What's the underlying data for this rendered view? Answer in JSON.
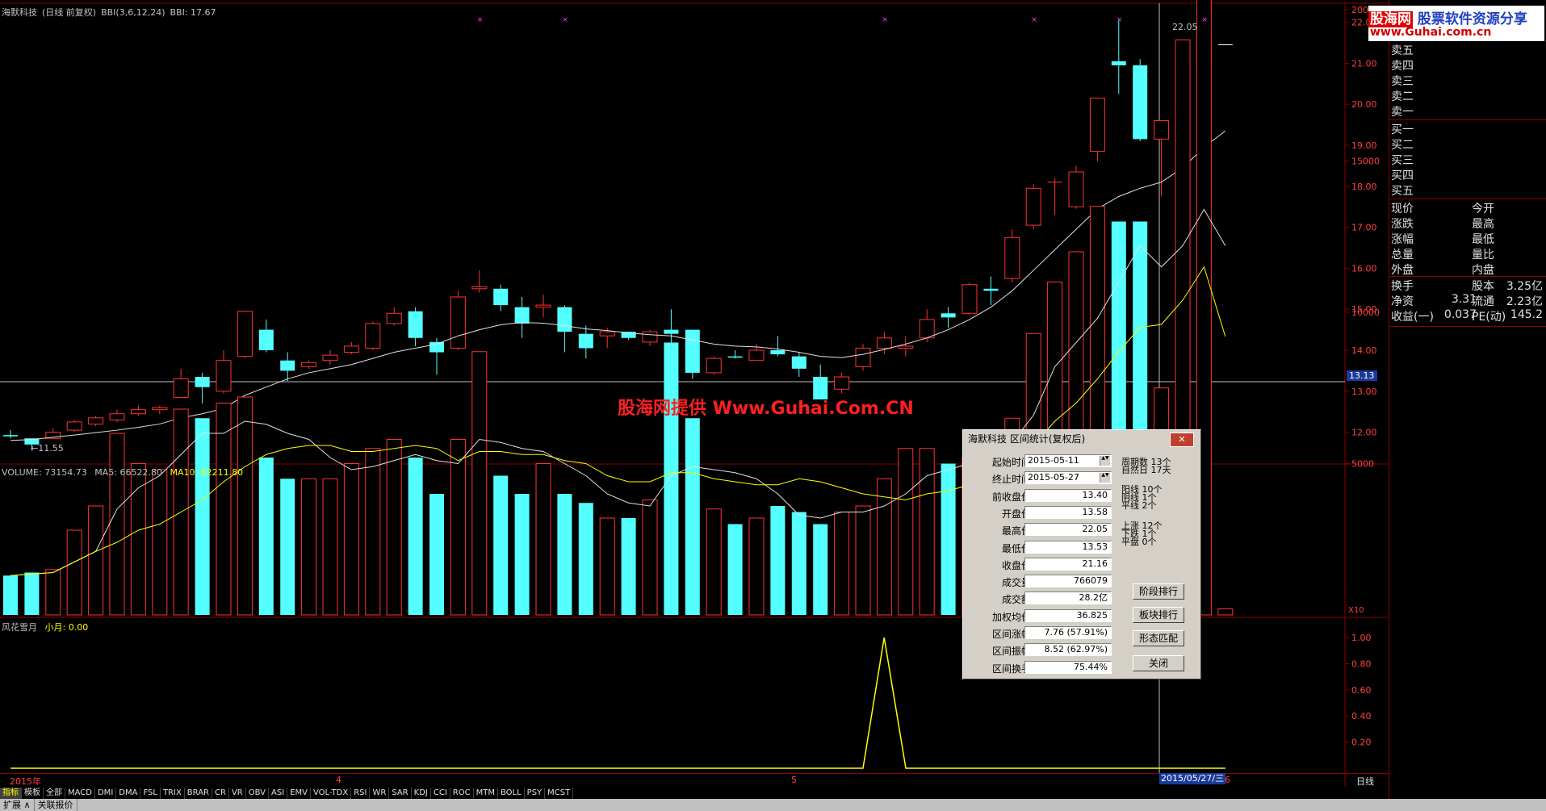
{
  "chart_header": {
    "stock_name": "海默科技",
    "mode": "(日线 前复权)",
    "bbi_params": "BBI(3,6,12,24)",
    "bbi_value": "BBI: 17.67"
  },
  "volume_header": {
    "volume": "VOLUME: 73154.73",
    "ma5": "MA5: 66522.80",
    "ma10": "MA10: 62211.80"
  },
  "indicator_header": {
    "name": "风花雪月",
    "line_label": "小月: 0.00"
  },
  "price_annotations": {
    "high": "22.05",
    "low": "←11.55",
    "crosshair_price": "13.13"
  },
  "watermark": "股海网提供 Www.Guhai.Com.CN",
  "logo": {
    "line1_a": "股海网",
    "line1_b": "股票软件资源分享",
    "line2": "www.Guhai.com.cn"
  },
  "order_book": {
    "sell": [
      "卖五",
      "卖四",
      "卖三",
      "卖二",
      "卖一"
    ],
    "buy": [
      "买一",
      "买二",
      "买三",
      "买四",
      "买五"
    ]
  },
  "quote_info": [
    [
      "现价",
      "",
      "今开",
      ""
    ],
    [
      "涨跌",
      "",
      "最高",
      ""
    ],
    [
      "涨幅",
      "",
      "最低",
      ""
    ],
    [
      "总量",
      "",
      "量比",
      ""
    ],
    [
      "外盘",
      "",
      "内盘",
      ""
    ]
  ],
  "quote_info2": [
    [
      "换手",
      "",
      "股本",
      "3.25亿"
    ],
    [
      "净资",
      "3.31",
      "流通",
      "2.23亿"
    ],
    [
      "收益(一)",
      "0.037",
      "PE(动)",
      "145.2"
    ]
  ],
  "dialog": {
    "title": "海默科技 区间统计(复权后)",
    "close": "✕",
    "fields": [
      {
        "label": "起始时间",
        "value": "2015-05-11"
      },
      {
        "label": "终止时间",
        "value": "2015-05-27"
      },
      {
        "label": "前收盘价",
        "value": "13.40"
      },
      {
        "label": "开盘价",
        "value": "13.58"
      },
      {
        "label": "最高价",
        "value": "22.05"
      },
      {
        "label": "最低价",
        "value": "13.53"
      },
      {
        "label": "收盘价",
        "value": "21.16"
      },
      {
        "label": "成交量",
        "value": "766079"
      },
      {
        "label": "成交额",
        "value": "28.2亿"
      },
      {
        "label": "加权均价",
        "value": "36.825"
      },
      {
        "label": "区间涨幅",
        "value": "7.76 (57.91%)"
      },
      {
        "label": "区间振幅",
        "value": "8.52 (62.97%)"
      },
      {
        "label": "区间换手",
        "value": "75.44%"
      }
    ],
    "stats": [
      "周期数 13个",
      "自然日 17天",
      "阳线 10个",
      "阴线 1个",
      "平线 2个",
      "上涨 12个",
      "下跌 1个",
      "平盘 0个"
    ],
    "buttons": [
      "阶段排行",
      "板块排行",
      "形态匹配",
      "关闭"
    ]
  },
  "tabs": [
    "指标",
    "模板",
    "全部",
    "MACD",
    "DMI",
    "DMA",
    "FSL",
    "TRIX",
    "BRAR",
    "CR",
    "VR",
    "OBV",
    "ASI",
    "EMV",
    "VOL-TDX",
    "RSI",
    "WR",
    "SAR",
    "KDJ",
    "CCI",
    "ROC",
    "MTM",
    "BOLL",
    "PSY",
    "MCST"
  ],
  "bottom_tabs": [
    "扩展 ∧",
    "关联报价"
  ],
  "date_axis": {
    "a": "2015年",
    "b": "4",
    "c": "5",
    "d": "6",
    "crosshair_date": "2015/05/27/三",
    "period": "日线"
  },
  "vol_axis_unit": "X10",
  "price_ticks": [
    "22.00",
    "21.00",
    "20.00",
    "19.00",
    "18.00",
    "17.00",
    "16.00",
    "15.00",
    "14.00",
    "13.00",
    "12.00"
  ],
  "vol_ticks": [
    "20000",
    "15000",
    "10000",
    "5000"
  ],
  "ind_ticks": [
    "1.00",
    "0.80",
    "0.60",
    "0.40",
    "0.20"
  ],
  "chart_data": {
    "type": "candlestick",
    "candles": [
      [
        11.93,
        11.9,
        12.05,
        11.85
      ],
      [
        11.85,
        11.7,
        11.8,
        11.55
      ],
      [
        11.85,
        12.0,
        12.1,
        11.85
      ],
      [
        12.05,
        12.25,
        12.3,
        12.0
      ],
      [
        12.2,
        12.35,
        12.4,
        12.15
      ],
      [
        12.3,
        12.45,
        12.55,
        12.25
      ],
      [
        12.45,
        12.55,
        12.65,
        12.4
      ],
      [
        12.55,
        12.6,
        12.65,
        12.45
      ],
      [
        12.85,
        13.3,
        13.55,
        12.85
      ],
      [
        13.35,
        13.1,
        13.45,
        12.7
      ],
      [
        13.0,
        13.75,
        14.0,
        12.95
      ],
      [
        13.85,
        14.95,
        14.95,
        13.8
      ],
      [
        14.5,
        14.0,
        14.75,
        13.95
      ],
      [
        13.75,
        13.5,
        13.95,
        13.25
      ],
      [
        13.6,
        13.7,
        13.75,
        13.55
      ],
      [
        13.75,
        13.88,
        14.0,
        13.65
      ],
      [
        13.95,
        14.1,
        14.2,
        13.9
      ],
      [
        14.05,
        14.65,
        14.7,
        14.0
      ],
      [
        14.65,
        14.9,
        15.05,
        14.6
      ],
      [
        14.95,
        14.3,
        15.05,
        14.1
      ],
      [
        14.2,
        13.95,
        14.3,
        13.4
      ],
      [
        14.05,
        15.3,
        15.45,
        14.0
      ],
      [
        15.5,
        15.55,
        15.95,
        15.4
      ],
      [
        15.5,
        15.1,
        15.6,
        14.95
      ],
      [
        15.05,
        14.65,
        15.3,
        14.3
      ],
      [
        15.05,
        15.1,
        15.35,
        14.8
      ],
      [
        15.05,
        14.45,
        15.1,
        13.95
      ],
      [
        14.4,
        14.05,
        14.6,
        13.8
      ],
      [
        14.35,
        14.45,
        14.55,
        14.05
      ],
      [
        14.45,
        14.3,
        14.45,
        14.25
      ],
      [
        14.2,
        14.45,
        14.5,
        14.1
      ],
      [
        14.5,
        14.4,
        15.0,
        14.05
      ],
      [
        14.5,
        13.45,
        14.5,
        13.3
      ],
      [
        13.45,
        13.8,
        13.85,
        13.4
      ],
      [
        13.85,
        13.82,
        14.0,
        13.8
      ],
      [
        13.75,
        14.0,
        14.15,
        13.75
      ],
      [
        14.0,
        13.9,
        14.35,
        13.85
      ],
      [
        13.85,
        13.55,
        13.95,
        13.35
      ],
      [
        13.35,
        12.8,
        13.65,
        12.8
      ],
      [
        13.05,
        13.35,
        13.45,
        12.95
      ],
      [
        13.6,
        14.05,
        14.15,
        13.5
      ],
      [
        14.05,
        14.3,
        14.45,
        13.9
      ],
      [
        14.05,
        14.1,
        14.35,
        13.85
      ],
      [
        14.3,
        14.75,
        15.0,
        14.2
      ],
      [
        14.9,
        14.8,
        15.05,
        14.55
      ],
      [
        14.9,
        15.6,
        15.65,
        14.85
      ],
      [
        15.5,
        15.45,
        15.8,
        15.1
      ],
      [
        15.75,
        16.75,
        16.95,
        15.65
      ],
      [
        17.05,
        17.95,
        18.05,
        16.95
      ],
      [
        18.1,
        18.1,
        18.2,
        17.3
      ],
      [
        17.5,
        18.35,
        18.5,
        17.45
      ],
      [
        18.85,
        20.15,
        20.15,
        18.6
      ],
      [
        21.05,
        20.95,
        22.05,
        20.25
      ],
      [
        20.95,
        19.15,
        21.1,
        19.1
      ],
      [
        19.15,
        19.6,
        19.6,
        17.75
      ],
      [
        19.75,
        21.0,
        21.5,
        19.4
      ],
      [
        20.95,
        21.45,
        22.05,
        20.45
      ],
      [
        21.45,
        21.45,
        21.45,
        21.45
      ]
    ],
    "bbi": [
      11.8,
      11.82,
      11.88,
      11.93,
      11.99,
      12.05,
      12.12,
      12.2,
      12.35,
      12.45,
      12.58,
      12.9,
      13.1,
      13.3,
      13.45,
      13.55,
      13.65,
      13.8,
      13.95,
      14.05,
      14.15,
      14.35,
      14.5,
      14.62,
      14.68,
      14.66,
      14.6,
      14.52,
      14.48,
      14.42,
      14.38,
      14.35,
      14.25,
      14.15,
      14.1,
      14.08,
      14.03,
      13.95,
      13.85,
      13.82,
      13.9,
      14.02,
      14.15,
      14.3,
      14.5,
      14.75,
      15.05,
      15.45,
      15.95,
      16.45,
      16.95,
      17.45,
      17.75,
      17.95,
      18.1,
      18.45,
      18.95,
      19.35
    ],
    "volume": [
      1300,
      1400,
      1500,
      2800,
      3600,
      6000,
      5000,
      4800,
      6800,
      6500,
      7000,
      7200,
      5200,
      4500,
      4500,
      4500,
      5000,
      5500,
      5800,
      5200,
      4000,
      5800,
      8700,
      4600,
      4000,
      5000,
      4000,
      3700,
      3200,
      3200,
      3800,
      9000,
      6500,
      3500,
      3000,
      3200,
      3600,
      3400,
      3000,
      3400,
      3600,
      4500,
      5500,
      5500,
      5000,
      5200,
      5500,
      6500,
      9300,
      11000,
      12000,
      13500,
      13000,
      13000,
      7500,
      19000,
      22000,
      200
    ],
    "vol_ma5": [
      1300,
      1350,
      1400,
      1750,
      2100,
      3500,
      4200,
      4600,
      5300,
      6000,
      6000,
      6400,
      6300,
      6000,
      5800,
      5200,
      4800,
      4900,
      5100,
      5300,
      5100,
      5000,
      5800,
      5700,
      5500,
      5400,
      5000,
      4600,
      4000,
      3700,
      3600,
      4600,
      4900,
      4800,
      4700,
      4500,
      4000,
      3300,
      3200,
      3400,
      3400,
      3600,
      4000,
      4600,
      4800,
      5000,
      5400,
      5700,
      6600,
      8200,
      9000,
      9800,
      11000,
      12200,
      11500,
      12200,
      13400,
      12200
    ],
    "vol_ma10": [
      1300,
      1350,
      1400,
      1750,
      2100,
      2400,
      2800,
      3000,
      3400,
      3800,
      4400,
      4900,
      5300,
      5500,
      5600,
      5600,
      5400,
      5400,
      5500,
      5600,
      5500,
      5100,
      5400,
      5400,
      5300,
      5300,
      5100,
      5000,
      4600,
      4400,
      4400,
      4700,
      4700,
      4500,
      4400,
      4300,
      4300,
      4500,
      4400,
      4200,
      4000,
      3900,
      3800,
      4000,
      4100,
      4300,
      4500,
      4900,
      5600,
      6400,
      7000,
      7800,
      8700,
      9500,
      9600,
      10400,
      11500,
      9200
    ],
    "indicator": {
      "peak_index": 41,
      "peak_value": 1.0,
      "baseline": 0.0
    }
  }
}
